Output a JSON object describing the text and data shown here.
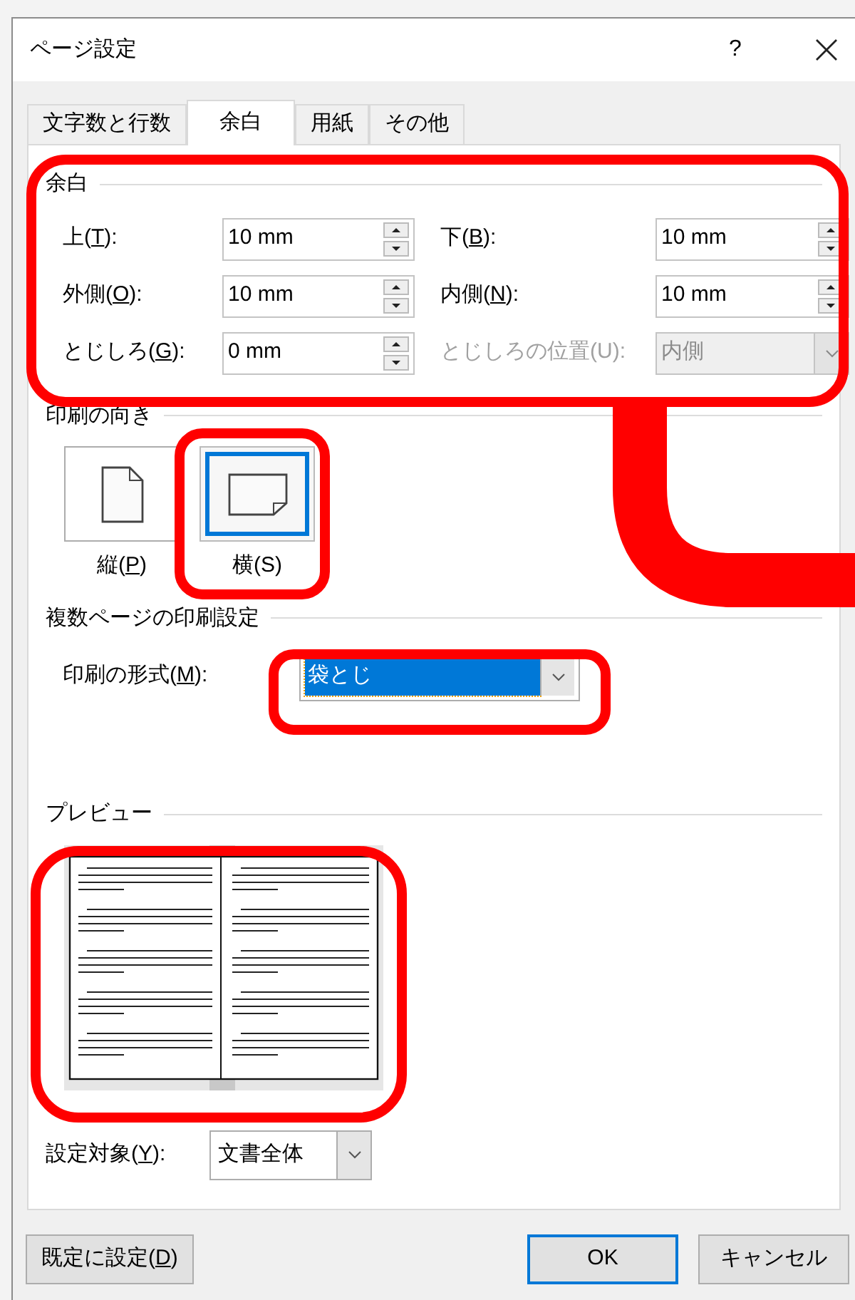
{
  "window": {
    "title": "ページ設定",
    "help": "?"
  },
  "tabs": [
    {
      "label": "文字数と行数",
      "selected": false
    },
    {
      "label": "余白",
      "selected": true
    },
    {
      "label": "用紙",
      "selected": false
    },
    {
      "label": "その他",
      "selected": false
    }
  ],
  "margins": {
    "heading": "余白",
    "fields": [
      {
        "kind": "spin",
        "label": [
          "上(",
          "T",
          "):"
        ],
        "value": "10 mm",
        "disabled": false
      },
      {
        "kind": "spin",
        "label": [
          "下(",
          "B",
          "):"
        ],
        "value": "10 mm",
        "disabled": false
      },
      {
        "kind": "spin",
        "label": [
          "外側(",
          "O",
          "):"
        ],
        "value": "10 mm",
        "disabled": false
      },
      {
        "kind": "spin",
        "label": [
          "内側(",
          "N",
          "):"
        ],
        "value": "10 mm",
        "disabled": false
      },
      {
        "kind": "spin",
        "label": [
          "とじしろ(",
          "G",
          "):"
        ],
        "value": "0 mm",
        "disabled": false
      },
      {
        "kind": "dropdown",
        "label": [
          "とじしろの位置(U):"
        ],
        "value": "内側",
        "disabled": true
      }
    ]
  },
  "orientation": {
    "heading": "印刷の向き",
    "options": [
      {
        "kind": "portrait",
        "label": [
          "縦(",
          "P",
          ")"
        ],
        "selected": false
      },
      {
        "kind": "landscape",
        "label": [
          "横(S)"
        ],
        "selected": true
      }
    ]
  },
  "multiple_pages": {
    "heading": "複数ページの印刷設定",
    "label": [
      "印刷の形式(",
      "M",
      "):"
    ],
    "value": "袋とじ",
    "focused": true
  },
  "preview": {
    "heading": "プレビュー"
  },
  "apply_to": {
    "label": [
      "設定対象(",
      "Y",
      "):"
    ],
    "value": "文書全体"
  },
  "buttons": [
    {
      "label": [
        "既定に設定(",
        "D",
        ")"
      ],
      "default": false
    },
    {
      "label": [
        "OK"
      ],
      "default": true
    },
    {
      "label": [
        "キャンセル"
      ],
      "default": false
    }
  ],
  "highlights": [
    {
      "kind": "outline"
    },
    {
      "kind": "outline"
    },
    {
      "kind": "outline"
    },
    {
      "kind": "outline"
    },
    {
      "kind": "connector"
    }
  ]
}
